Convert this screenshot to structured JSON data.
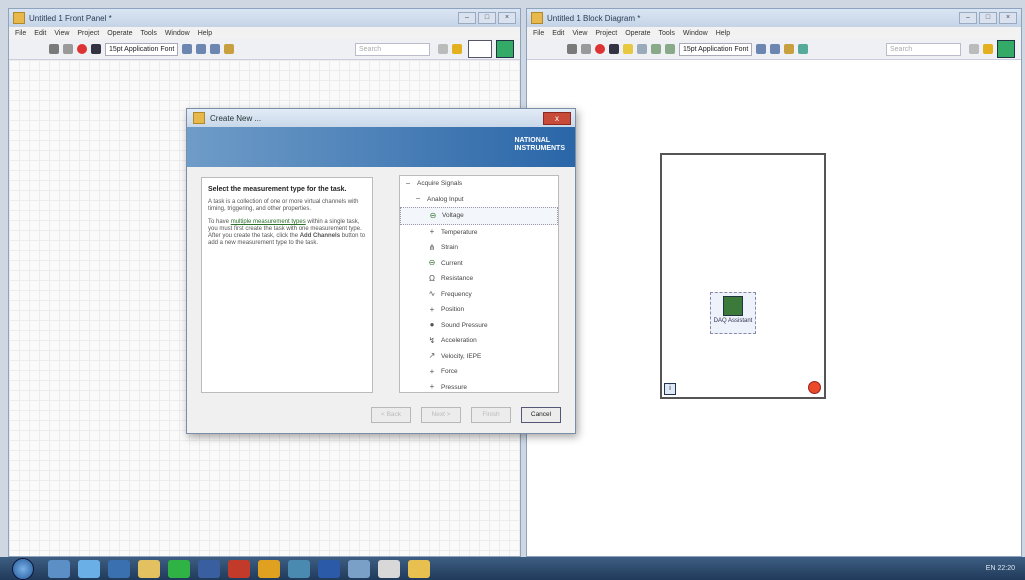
{
  "front_panel": {
    "title": "Untitled 1 Front Panel *",
    "menu": [
      "File",
      "Edit",
      "View",
      "Project",
      "Operate",
      "Tools",
      "Window",
      "Help"
    ],
    "font": "15pt Application Font",
    "search_placeholder": "Search"
  },
  "block_diagram": {
    "title": "Untitled 1 Block Diagram *",
    "menu": [
      "File",
      "Edit",
      "View",
      "Project",
      "Operate",
      "Tools",
      "Window",
      "Help"
    ],
    "font": "15pt Application Font",
    "search_placeholder": "Search",
    "daq_label": "DAQ Assistant",
    "iteration_label": "i"
  },
  "dialog": {
    "title": "Create New ...",
    "close": "x",
    "logo_line1": "NATIONAL",
    "logo_line2": "INSTRUMENTS",
    "heading": "Select the measurement type for the task.",
    "para1": "A task is a collection of one or more virtual channels with timing, triggering, and other properties.",
    "para2_prefix": "To have ",
    "para2_link": "multiple measurement types",
    "para2_suffix": " within a single task, you must first create the task with one measurement type. After you create the task, click the ",
    "para2_bold": "Add Channels",
    "para2_end": " button to add a new measurement type to the task.",
    "tree": [
      {
        "label": "Acquire Signals",
        "icon": "minus",
        "indent": 0
      },
      {
        "label": "Analog Input",
        "icon": "minus",
        "indent": 1
      },
      {
        "label": "Voltage",
        "icon": "voltage-icon",
        "indent": 2
      },
      {
        "label": "Temperature",
        "icon": "temperature-icon",
        "indent": 2
      },
      {
        "label": "Strain",
        "icon": "strain-icon",
        "indent": 2
      },
      {
        "label": "Current",
        "icon": "current-icon",
        "indent": 2
      },
      {
        "label": "Resistance",
        "icon": "resistance-icon",
        "indent": 2
      },
      {
        "label": "Frequency",
        "icon": "frequency-icon",
        "indent": 2
      },
      {
        "label": "Position",
        "icon": "position-icon",
        "indent": 2
      },
      {
        "label": "Sound Pressure",
        "icon": "sound-icon",
        "indent": 2
      },
      {
        "label": "Acceleration",
        "icon": "acceleration-icon",
        "indent": 2
      },
      {
        "label": "Velocity, IEPE",
        "icon": "velocity-icon",
        "indent": 2
      },
      {
        "label": "Force",
        "icon": "force-icon",
        "indent": 2
      },
      {
        "label": "Pressure",
        "icon": "pressure-icon",
        "indent": 2
      }
    ],
    "buttons": {
      "back": "< Back",
      "next": "Next >",
      "finish": "Finish",
      "cancel": "Cancel"
    }
  },
  "taskbar": {
    "time": "22:20",
    "lang": "EN"
  }
}
